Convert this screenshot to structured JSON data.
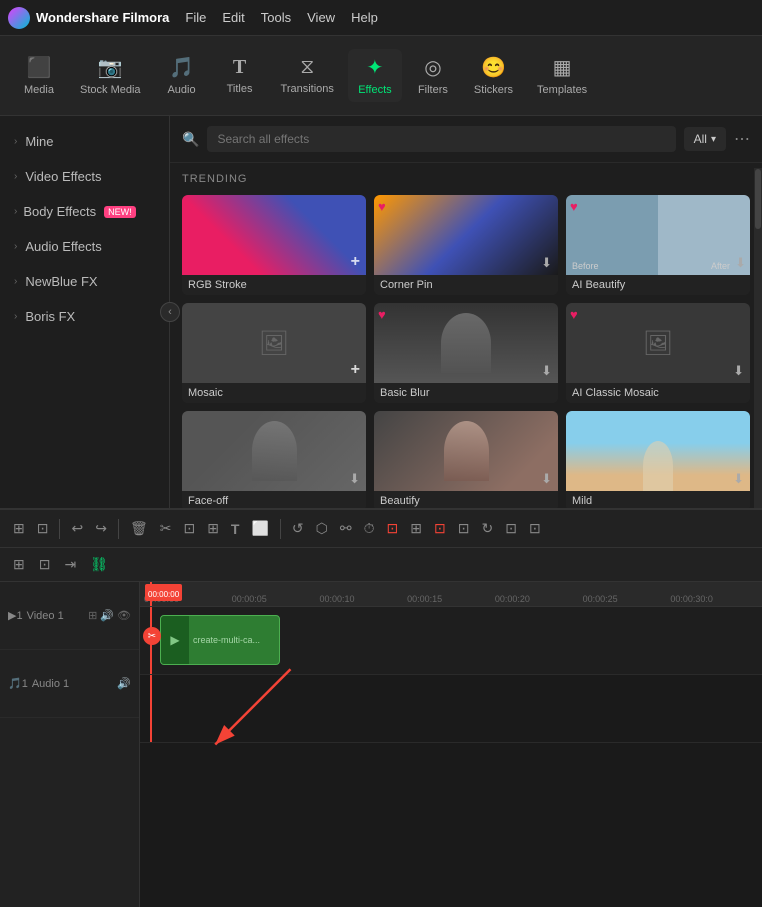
{
  "app": {
    "name": "Wondershare Filmora",
    "logo_color": "#e040fb"
  },
  "menu": {
    "items": [
      "File",
      "Edit",
      "Tools",
      "View",
      "Help"
    ]
  },
  "toolbar": {
    "items": [
      {
        "id": "media",
        "label": "Media",
        "icon": "⬛"
      },
      {
        "id": "stock-media",
        "label": "Stock Media",
        "icon": "🎞"
      },
      {
        "id": "audio",
        "label": "Audio",
        "icon": "🎵"
      },
      {
        "id": "titles",
        "label": "Titles",
        "icon": "T"
      },
      {
        "id": "transitions",
        "label": "Transitions",
        "icon": "⧖"
      },
      {
        "id": "effects",
        "label": "Effects",
        "icon": "✦"
      },
      {
        "id": "filters",
        "label": "Filters",
        "icon": "◎"
      },
      {
        "id": "stickers",
        "label": "Stickers",
        "icon": "😊"
      },
      {
        "id": "templates",
        "label": "Templates",
        "icon": "▦"
      }
    ],
    "active": "effects"
  },
  "sidebar": {
    "items": [
      {
        "id": "mine",
        "label": "Mine",
        "arrow": "›"
      },
      {
        "id": "video-effects",
        "label": "Video Effects",
        "arrow": "›"
      },
      {
        "id": "body-effects",
        "label": "Body Effects",
        "arrow": "›",
        "badge": "NEW!"
      },
      {
        "id": "audio-effects",
        "label": "Audio Effects",
        "arrow": "›"
      },
      {
        "id": "newblue-fx",
        "label": "NewBlue FX",
        "arrow": "›"
      },
      {
        "id": "boris-fx",
        "label": "Boris FX",
        "arrow": "›"
      }
    ]
  },
  "search": {
    "placeholder": "Search all effects",
    "filter_label": "All",
    "more_icon": "⋯"
  },
  "effects": {
    "section_title": "TRENDING",
    "items": [
      {
        "id": "rgb-stroke",
        "label": "RGB Stroke",
        "thumb": "rgb",
        "heart": true,
        "download": false,
        "add": true
      },
      {
        "id": "corner-pin",
        "label": "Corner Pin",
        "thumb": "corner",
        "heart": true,
        "download": true,
        "add": false
      },
      {
        "id": "ai-beautify",
        "label": "AI Beautify",
        "thumb": "beautify",
        "heart": true,
        "download": true,
        "add": false
      },
      {
        "id": "mosaic",
        "label": "Mosaic",
        "thumb": "mosaic",
        "heart": false,
        "download": false,
        "add": true
      },
      {
        "id": "basic-blur",
        "label": "Basic Blur",
        "thumb": "basic-blur",
        "heart": true,
        "download": true,
        "add": false
      },
      {
        "id": "ai-classic-mosaic",
        "label": "AI Classic Mosaic",
        "thumb": "ai-mosaic",
        "heart": true,
        "download": true,
        "add": false
      },
      {
        "id": "face-off",
        "label": "Face-off",
        "thumb": "faceoff",
        "heart": false,
        "download": true,
        "add": false
      },
      {
        "id": "beautify",
        "label": "Beautify",
        "thumb": "beautify2",
        "heart": false,
        "download": true,
        "add": false
      },
      {
        "id": "mild",
        "label": "Mild",
        "thumb": "mild",
        "heart": false,
        "download": true,
        "add": false
      },
      {
        "id": "row3-1",
        "label": "",
        "thumb": "row3-1",
        "heart": false,
        "download": false,
        "add": true
      },
      {
        "id": "row3-2",
        "label": "",
        "thumb": "row3-2",
        "heart": false,
        "download": true,
        "add": false
      },
      {
        "id": "row3-3",
        "label": "",
        "thumb": "row3-3",
        "heart": false,
        "download": true,
        "add": false
      }
    ]
  },
  "timeline": {
    "toolbar_buttons": [
      "⊞",
      "⊡",
      "⇥",
      "⛓",
      "↩",
      "↪",
      "🗑",
      "✂",
      "⊡",
      "⊞",
      "T",
      "⬜",
      "↺",
      "⬡",
      "⚯",
      "⏱",
      "⊡",
      "⊞",
      "⊡",
      "⊡"
    ],
    "tracks": [
      {
        "id": "video-1",
        "label": "Video 1",
        "type": "video",
        "num": "▶1"
      },
      {
        "id": "audio-1",
        "label": "Audio 1",
        "type": "audio",
        "num": "🎵1"
      }
    ],
    "ruler_marks": [
      "00:00:00",
      "00:00:05",
      "00:00:10",
      "00:00:15",
      "00:00:20",
      "00:00:25",
      "00:00:30:0"
    ],
    "clip": {
      "label": "create-multi-ca...",
      "icon": "▶"
    },
    "playhead_time": "00:00:00"
  }
}
